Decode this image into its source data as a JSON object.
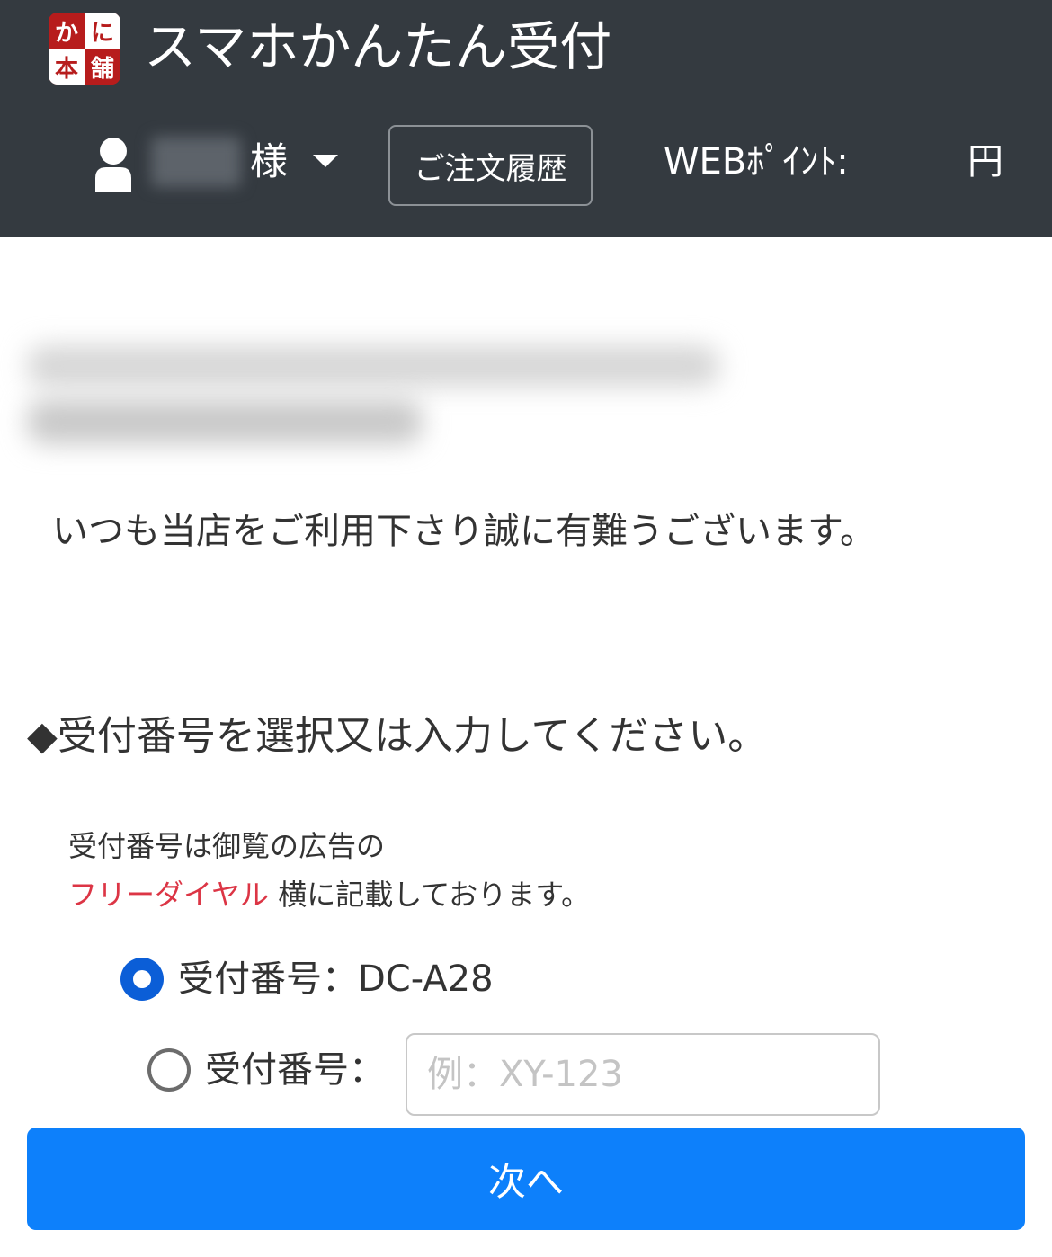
{
  "header": {
    "logo": {
      "chars": [
        "か",
        "に",
        "本",
        "舗"
      ]
    },
    "title": "スマホかんたん受付",
    "user": {
      "suffix": "様"
    },
    "order_history_label": "ご注文履歴",
    "web_points": {
      "label": "WEBﾎﾟｲﾝﾄ:",
      "unit": "円"
    }
  },
  "main": {
    "greeting": "いつも当店をご利用下さり誠に有難うございます。",
    "section_heading": "◆受付番号を選択又は入力してください。",
    "note": {
      "line1": "受付番号は御覧の広告の",
      "highlight": "フリーダイヤル",
      "line2_rest": " 横に記載しております。"
    },
    "options": [
      {
        "label": "受付番号：DC-A28",
        "checked": true
      },
      {
        "label": "受付番号：",
        "checked": false
      }
    ],
    "code_input": {
      "value": "",
      "placeholder": "例：XY-123"
    },
    "next_button_label": "次へ"
  },
  "colors": {
    "header_bg": "#343a40",
    "primary": "#0d80fb",
    "radio_checked": "#0b5ed7",
    "highlight_red": "#dc3545",
    "logo_red": "#b71c1c"
  },
  "icons": [
    "user-icon",
    "caret-down-icon",
    "logo-icon"
  ]
}
